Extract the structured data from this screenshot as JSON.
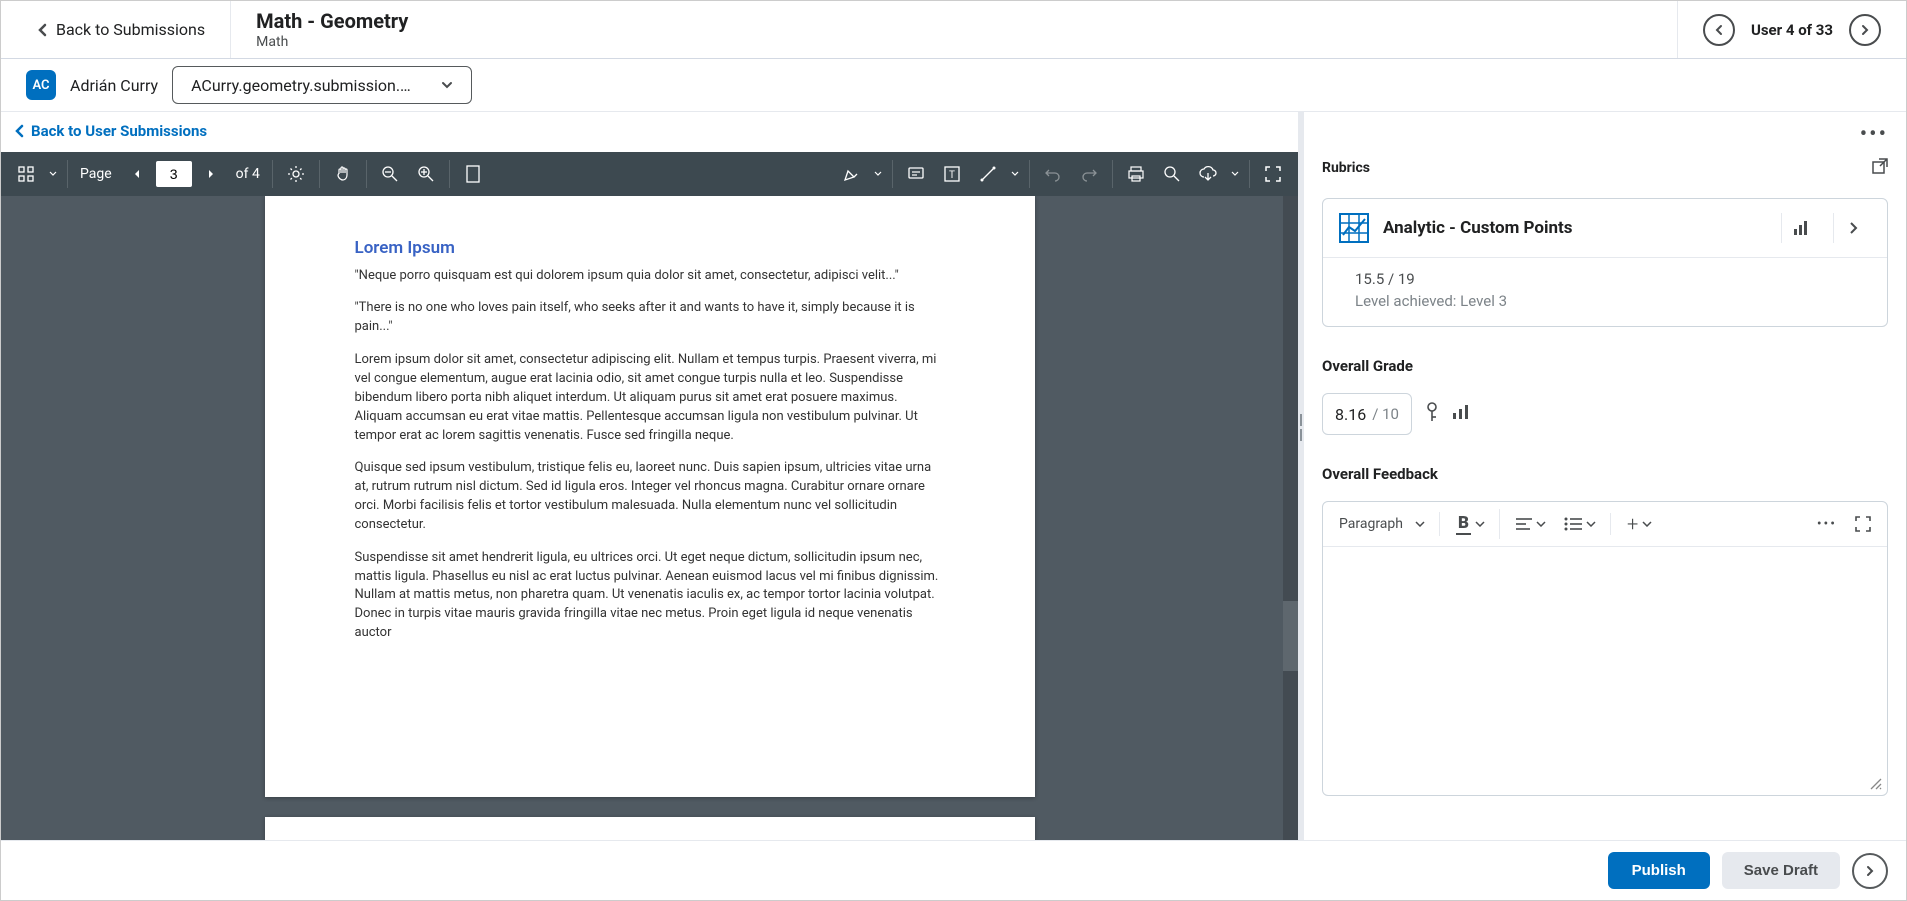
{
  "header": {
    "back_label": "Back to Submissions",
    "title": "Math - Geometry",
    "subtitle": "Math",
    "user_position": "User 4 of 33"
  },
  "student": {
    "initials": "AC",
    "name": "Adrián Curry",
    "file_name": "ACurry.geometry.submission...."
  },
  "back_user_link": "Back to User Submissions",
  "pdf": {
    "page_label": "Page",
    "current_page": "3",
    "total_label": "of 4"
  },
  "document": {
    "heading": "Lorem Ipsum",
    "quote1": "\"Neque porro quisquam est qui dolorem ipsum quia dolor sit amet, consectetur, adipisci velit...\"",
    "quote2": "\"There is no one who loves pain itself, who seeks after it and wants to have it, simply because it is pain...\"",
    "para1": "Lorem ipsum dolor sit amet, consectetur adipiscing elit. Nullam et tempus turpis. Praesent viverra, mi vel congue elementum, augue erat lacinia odio, sit amet congue turpis nulla et leo. Suspendisse bibendum libero porta nibh aliquet interdum. Ut aliquam purus sit amet erat posuere maximus. Aliquam accumsan eu erat vitae mattis. Pellentesque accumsan ligula non vestibulum pulvinar. Ut tempor erat ac lorem sagittis venenatis. Fusce sed fringilla neque.",
    "para2": "Quisque sed ipsum vestibulum, tristique felis eu, laoreet nunc. Duis sapien ipsum, ultricies vitae urna at, rutrum rutrum nisl dictum. Sed id ligula eros. Integer vel rhoncus magna. Curabitur ornare ornare orci. Morbi facilisis felis et tortor vestibulum malesuada. Nulla elementum nunc vel sollicitudin consectetur.",
    "para3": "Suspendisse sit amet hendrerit ligula, eu ultrices orci. Ut eget neque dictum, sollicitudin ipsum nec, mattis ligula. Phasellus eu nisl ac erat luctus pulvinar. Aenean euismod lacus vel mi finibus dignissim. Nullam at mattis metus, non pharetra quam. Ut venenatis iaculis ex, ac tempor tortor lacinia volutpat. Donec in turpis vitae mauris gravida fringilla vitae nec metus. Proin eget ligula id neque venenatis auctor"
  },
  "rubrics": {
    "section_label": "Rubrics",
    "title": "Analytic - Custom Points",
    "score": "15.5 / 19",
    "level": "Level achieved: Level 3"
  },
  "grade": {
    "section_label": "Overall Grade",
    "value": "8.16",
    "max": "/ 10"
  },
  "feedback": {
    "section_label": "Overall Feedback",
    "format_label": "Paragraph"
  },
  "footer": {
    "publish": "Publish",
    "save_draft": "Save Draft"
  }
}
